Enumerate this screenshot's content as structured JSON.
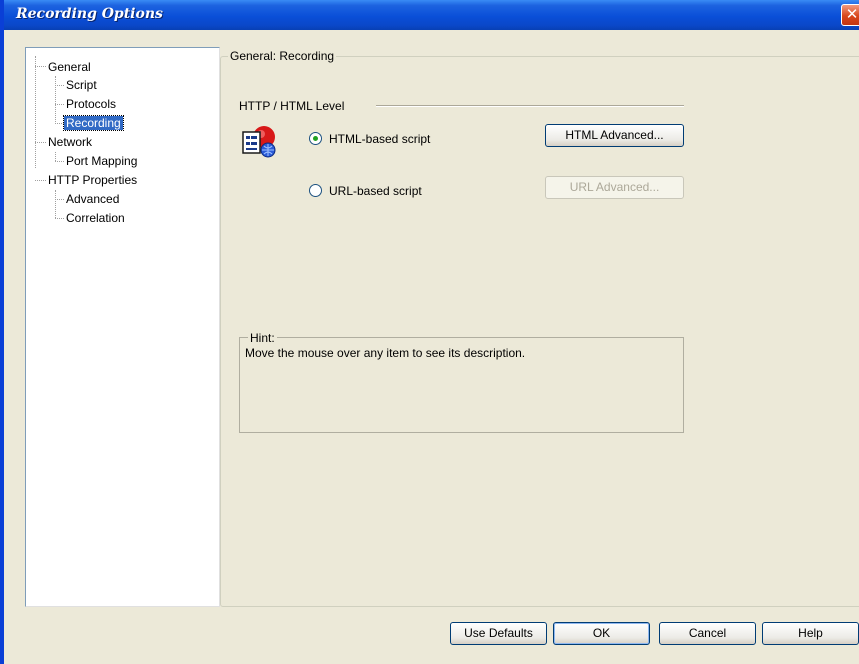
{
  "window": {
    "title": "Recording Options",
    "close_glyph": "✕"
  },
  "tree": {
    "items": [
      {
        "label": "General"
      },
      {
        "label": "Script"
      },
      {
        "label": "Protocols"
      },
      {
        "label": "Recording",
        "selected": true
      },
      {
        "label": "Network"
      },
      {
        "label": "Port Mapping"
      },
      {
        "label": "HTTP Properties"
      },
      {
        "label": "Advanced"
      },
      {
        "label": "Correlation"
      }
    ]
  },
  "panel": {
    "group_title": "General: Recording",
    "section_title": "HTTP / HTML Level",
    "icon": "script-document-icon",
    "options": [
      {
        "label": "HTML-based script",
        "selected": true,
        "button": "HTML Advanced...",
        "button_enabled": true
      },
      {
        "label": "URL-based script",
        "selected": false,
        "button": "URL Advanced...",
        "button_enabled": false
      }
    ],
    "hint": {
      "title": "Hint:",
      "text": "Move the mouse over any item to see its description."
    }
  },
  "footer": {
    "use_defaults": "Use Defaults",
    "ok": "OK",
    "cancel": "Cancel",
    "help": "Help"
  }
}
